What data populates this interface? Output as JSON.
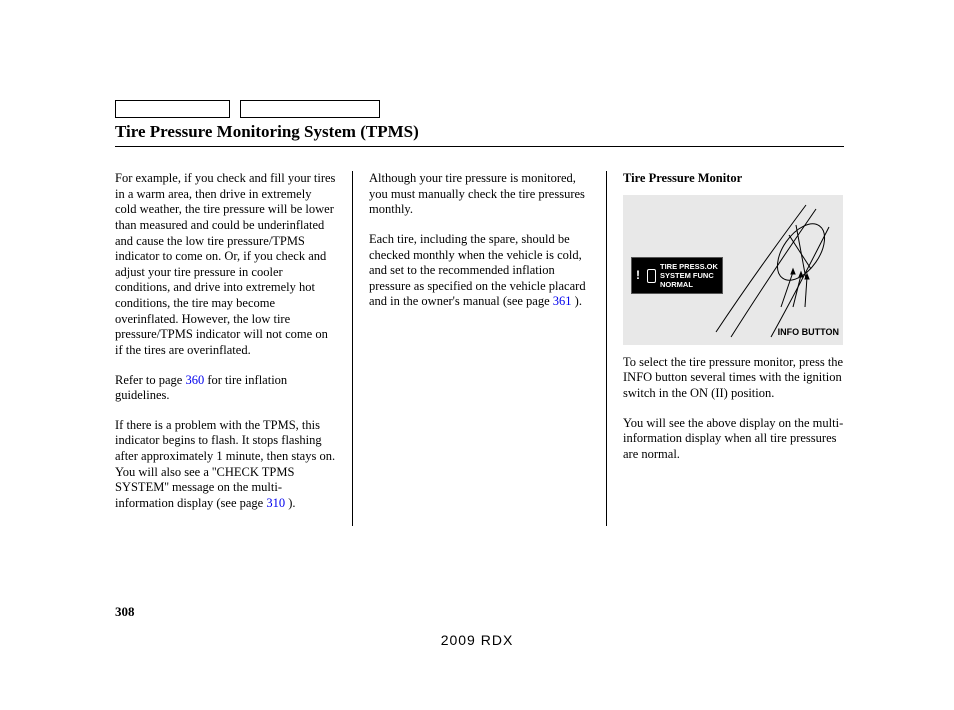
{
  "title": "Tire Pressure Monitoring System (TPMS)",
  "col1": {
    "p1": "For example, if you check and fill your tires in a warm area, then drive in extremely cold weather, the tire pressure will be lower than measured and could be underinflated and cause the low tire pressure/TPMS indicator to come on. Or, if you check and adjust your tire pressure in cooler conditions, and drive into extremely hot conditions, the tire may become overinflated. However, the low tire pressure/TPMS indicator will not come on if the tires are overinflated.",
    "p2a": "Refer to page ",
    "p2link": "360",
    "p2b": " for tire inflation guidelines.",
    "p3a": "If there is a problem with the TPMS, this indicator begins to flash. It stops flashing after approximately 1 minute, then stays on. You will also see a ''CHECK TPMS SYSTEM'' message on the multi-information display (see page ",
    "p3link": "310",
    "p3b": " )."
  },
  "col2": {
    "p1": "Although your tire pressure is monitored, you must manually check the tire pressures monthly.",
    "p2a": "Each tire, including the spare, should be checked monthly when the vehicle is cold, and set to the recommended inflation pressure as specified on the vehicle placard and in the owner's manual (see page",
    "p2link": " 361",
    "p2b": " )."
  },
  "col3": {
    "heading": "Tire Pressure Monitor",
    "display": {
      "line1": "TIRE PRESS.OK",
      "line2": "SYSTEM FUNC",
      "line3": "NORMAL"
    },
    "info_label": "INFO BUTTON",
    "p1": "To select the tire pressure monitor, press the INFO button several times with the ignition switch in the ON (II) position.",
    "p2": "You will see the above display on the multi-information display when all tire pressures are normal."
  },
  "page_number": "308",
  "model": "2009  RDX"
}
